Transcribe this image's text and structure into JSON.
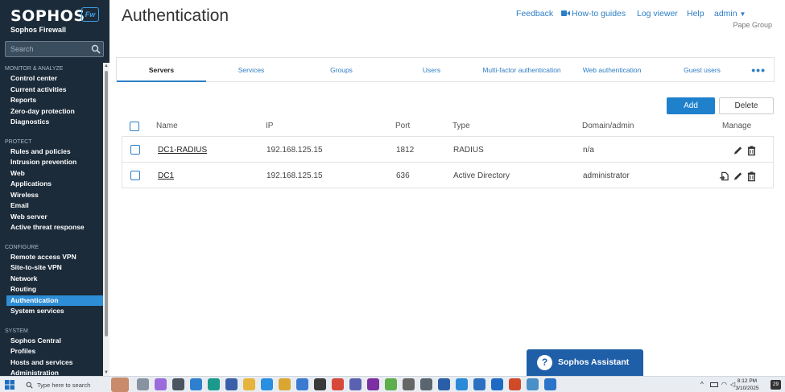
{
  "sidebar": {
    "brand": "SOPHOS",
    "fw_badge": "Fw",
    "product": "Sophos Firewall",
    "search_placeholder": "Search",
    "sections": [
      {
        "title": "MONITOR & ANALYZE",
        "items": [
          "Control center",
          "Current activities",
          "Reports",
          "Zero-day protection",
          "Diagnostics"
        ]
      },
      {
        "title": "PROTECT",
        "items": [
          "Rules and policies",
          "Intrusion prevention",
          "Web",
          "Applications",
          "Wireless",
          "Email",
          "Web server",
          "Active threat response"
        ]
      },
      {
        "title": "CONFIGURE",
        "items": [
          "Remote access VPN",
          "Site-to-site VPN",
          "Network",
          "Routing",
          "Authentication",
          "System services"
        ]
      },
      {
        "title": "SYSTEM",
        "items": [
          "Sophos Central",
          "Profiles",
          "Hosts and services",
          "Administration"
        ]
      }
    ],
    "active_item": "Authentication"
  },
  "header": {
    "title": "Authentication",
    "links": {
      "feedback": "Feedback",
      "howto": "How-to guides",
      "logviewer": "Log viewer",
      "help": "Help",
      "admin": "admin"
    },
    "organization": "Pape Group"
  },
  "tabs": [
    "Servers",
    "Services",
    "Groups",
    "Users",
    "Multi-factor authentication",
    "Web authentication",
    "Guest users"
  ],
  "active_tab": "Servers",
  "toolbar": {
    "add": "Add",
    "delete": "Delete"
  },
  "table": {
    "headers": {
      "name": "Name",
      "ip": "IP",
      "port": "Port",
      "type": "Type",
      "domain": "Domain/admin",
      "manage": "Manage"
    },
    "rows": [
      {
        "name": "DC1-RADIUS",
        "ip": "192.168.125.15",
        "port": "1812",
        "type": "RADIUS",
        "domain": "n/a"
      },
      {
        "name": "DC1",
        "ip": "192.168.125.15",
        "port": "636",
        "type": "Active Directory",
        "domain": "administrator"
      }
    ]
  },
  "assistant": {
    "label": "Sophos Assistant",
    "icon": "?"
  },
  "taskbar": {
    "search_placeholder": "Type here to search",
    "time": "8:12 PM",
    "date": "3/10/2025",
    "notification_count": "29"
  },
  "colors": {
    "sidebar_bg": "#1b2b3a",
    "accent": "#2d7ec6",
    "active_nav": "#2d8ed6",
    "assistant_bg": "#1f5fa8"
  }
}
